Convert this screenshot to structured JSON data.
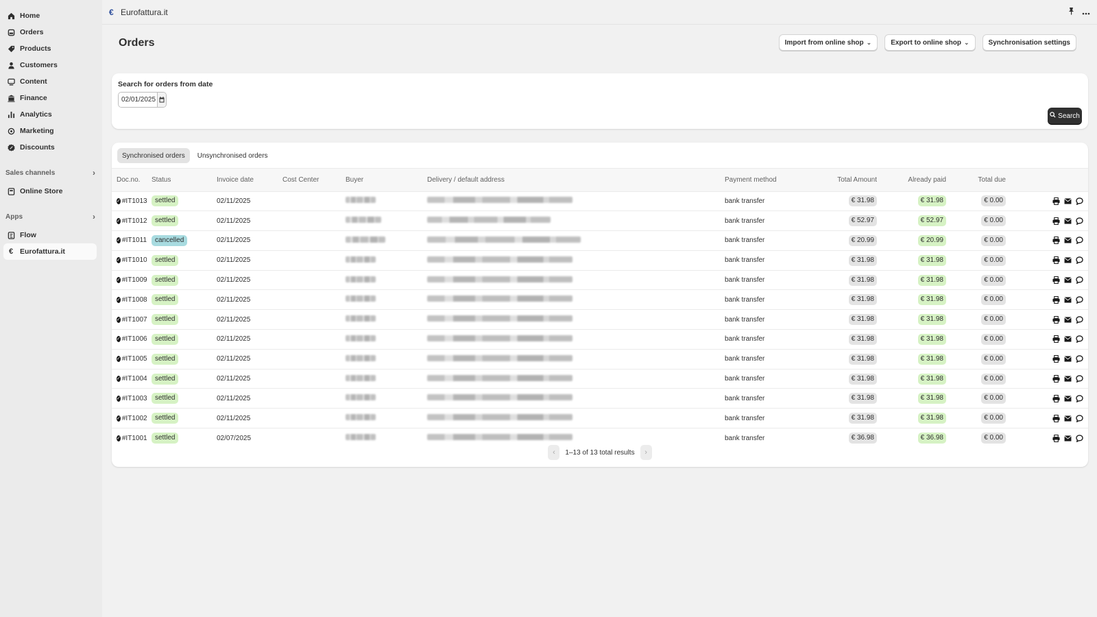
{
  "nav": {
    "items": [
      {
        "label": "Home",
        "icon": "home-icon"
      },
      {
        "label": "Orders",
        "icon": "orders-icon"
      },
      {
        "label": "Products",
        "icon": "tag-icon"
      },
      {
        "label": "Customers",
        "icon": "person-icon"
      },
      {
        "label": "Content",
        "icon": "content-icon"
      },
      {
        "label": "Finance",
        "icon": "bank-icon"
      },
      {
        "label": "Analytics",
        "icon": "bar-chart-icon"
      },
      {
        "label": "Marketing",
        "icon": "target-icon"
      },
      {
        "label": "Discounts",
        "icon": "discount-icon"
      }
    ],
    "sales_channels_label": "Sales channels",
    "online_store_label": "Online Store",
    "apps_label": "Apps",
    "flow_label": "Flow",
    "eurofattura_label": "Eurofattura.it"
  },
  "topbar": {
    "app_name": "Eurofattura.it"
  },
  "page": {
    "title": "Orders",
    "import_button": "Import from online shop",
    "export_button": "Export to online shop",
    "sync_button": "Synchronisation settings"
  },
  "search": {
    "label": "Search for orders from date",
    "date_value": "02/01/2025",
    "button_label": "Search"
  },
  "tabs": {
    "synchronised": "Synchronised orders",
    "unsynchronised": "Unsynchronised orders"
  },
  "table": {
    "headers": {
      "docno": "Doc.no.",
      "status": "Status",
      "invoice_date": "Invoice date",
      "cost_center": "Cost Center",
      "buyer": "Buyer",
      "address": "Delivery / default address",
      "payment": "Payment method",
      "total": "Total Amount",
      "paid": "Already paid",
      "due": "Total due"
    },
    "rows": [
      {
        "docno": "#IT1013",
        "status": "settled",
        "date": "02/11/2025",
        "payment": "bank transfer",
        "total": "€ 31.98",
        "paid": "€ 31.98",
        "due": "€ 0.00"
      },
      {
        "docno": "#IT1012",
        "status": "settled",
        "date": "02/11/2025",
        "payment": "bank transfer",
        "total": "€ 52.97",
        "paid": "€ 52.97",
        "due": "€ 0.00"
      },
      {
        "docno": "#IT1011",
        "status": "cancelled",
        "date": "02/11/2025",
        "payment": "bank transfer",
        "total": "€ 20.99",
        "paid": "€ 20.99",
        "due": "€ 0.00"
      },
      {
        "docno": "#IT1010",
        "status": "settled",
        "date": "02/11/2025",
        "payment": "bank transfer",
        "total": "€ 31.98",
        "paid": "€ 31.98",
        "due": "€ 0.00"
      },
      {
        "docno": "#IT1009",
        "status": "settled",
        "date": "02/11/2025",
        "payment": "bank transfer",
        "total": "€ 31.98",
        "paid": "€ 31.98",
        "due": "€ 0.00"
      },
      {
        "docno": "#IT1008",
        "status": "settled",
        "date": "02/11/2025",
        "payment": "bank transfer",
        "total": "€ 31.98",
        "paid": "€ 31.98",
        "due": "€ 0.00"
      },
      {
        "docno": "#IT1007",
        "status": "settled",
        "date": "02/11/2025",
        "payment": "bank transfer",
        "total": "€ 31.98",
        "paid": "€ 31.98",
        "due": "€ 0.00"
      },
      {
        "docno": "#IT1006",
        "status": "settled",
        "date": "02/11/2025",
        "payment": "bank transfer",
        "total": "€ 31.98",
        "paid": "€ 31.98",
        "due": "€ 0.00"
      },
      {
        "docno": "#IT1005",
        "status": "settled",
        "date": "02/11/2025",
        "payment": "bank transfer",
        "total": "€ 31.98",
        "paid": "€ 31.98",
        "due": "€ 0.00"
      },
      {
        "docno": "#IT1004",
        "status": "settled",
        "date": "02/11/2025",
        "payment": "bank transfer",
        "total": "€ 31.98",
        "paid": "€ 31.98",
        "due": "€ 0.00"
      },
      {
        "docno": "#IT1003",
        "status": "settled",
        "date": "02/11/2025",
        "payment": "bank transfer",
        "total": "€ 31.98",
        "paid": "€ 31.98",
        "due": "€ 0.00"
      },
      {
        "docno": "#IT1002",
        "status": "settled",
        "date": "02/11/2025",
        "payment": "bank transfer",
        "total": "€ 31.98",
        "paid": "€ 31.98",
        "due": "€ 0.00"
      },
      {
        "docno": "#IT1001",
        "status": "settled",
        "date": "02/07/2025",
        "payment": "bank transfer",
        "total": "€ 36.98",
        "paid": "€ 36.98",
        "due": "€ 0.00"
      }
    ]
  },
  "pagination": {
    "text": "1–13 of 13 total results"
  },
  "colors": {
    "settled": "#d6f2c4",
    "cancelled": "#a8dbe0",
    "primary_button": "#303030"
  }
}
